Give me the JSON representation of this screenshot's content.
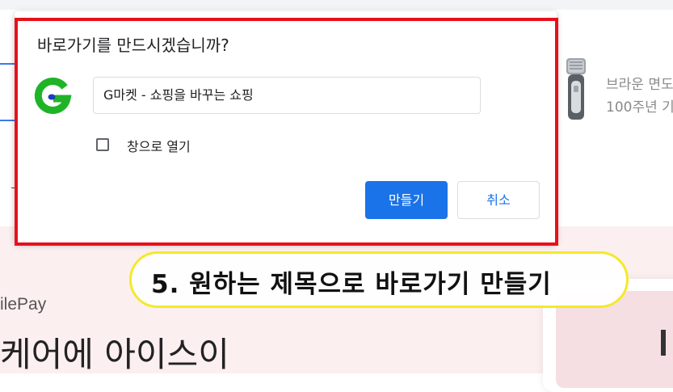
{
  "dialog": {
    "title": "바로가기를 만드시겠습니까?",
    "site_icon": "g-market-logo-icon",
    "name_value": "G마켓 - 쇼핑을 바꾸는 쇼핑",
    "open_as_window_label": "창으로 열기",
    "open_as_window_checked": false,
    "create_button": "만들기",
    "cancel_button": "취소"
  },
  "annotation": {
    "step_text": "5. 원하는 제목으로 바로가기 만들기",
    "highlight_color": "#e8101c",
    "callout_border_color": "#f2ea2a"
  },
  "background_page": {
    "product_line1": "브라운 면도",
    "product_line2": "100주년 기",
    "pay_label": "ilePay",
    "headline_fragment": "케어에 아이스이"
  },
  "colors": {
    "primary_button": "#1a73e8",
    "logo_green": "#1fb427",
    "logo_blue": "#1b3dbf"
  }
}
